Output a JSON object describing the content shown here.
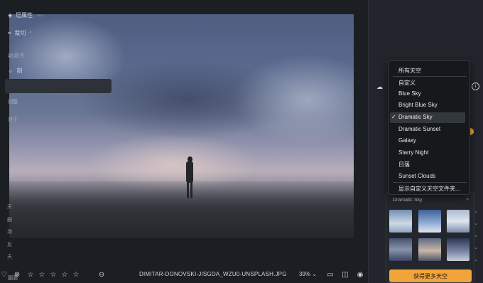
{
  "panel": {
    "layer_props": "层属性",
    "layer_pro": "PRO",
    "crop": "裁切",
    "crop_suffix": "^",
    "favorites": "收藏夹",
    "partial_left_1": "刻",
    "partial_left_2": "调整",
    "partial_left_3": "对于",
    "left_rows": [
      "天",
      "删",
      "场",
      "反",
      "天"
    ],
    "bottom_partial": "圖面"
  },
  "dropdown": {
    "items": [
      "所有天空",
      "自定义",
      "Blue Sky",
      "Bright Blue Sky",
      "Dramatic Sky",
      "Dramatic Sunset",
      "Galaxy",
      "Starry Night",
      "日落",
      "Sunset Clouds",
      "显示自定义天空文件夹..."
    ],
    "selected": "Dramatic Sky",
    "check_mark": "✓"
  },
  "sky_popup": {
    "current": "Dramatic Sky",
    "more_button": "获得更多天空"
  },
  "bottombar": {
    "filename": "DIMITAR-DONOVSKI-JISGDA_WZU0-UNSPLASH.JPG",
    "zoom": "39%",
    "zoom_chevron": "⌄",
    "star_glyph": "☆",
    "rating": 0
  },
  "icons": [
    "heart-icon",
    "reject-icon",
    "star-icon",
    "minus-circle-icon",
    "compare-icon",
    "split-view-icon",
    "eye-icon",
    "layers-icon",
    "crop-icon",
    "sun-icon",
    "cloud-icon",
    "info-icon"
  ],
  "colors": {
    "accent": "#f0a43a",
    "panel": "#22252b",
    "bg": "#1b1e23"
  }
}
